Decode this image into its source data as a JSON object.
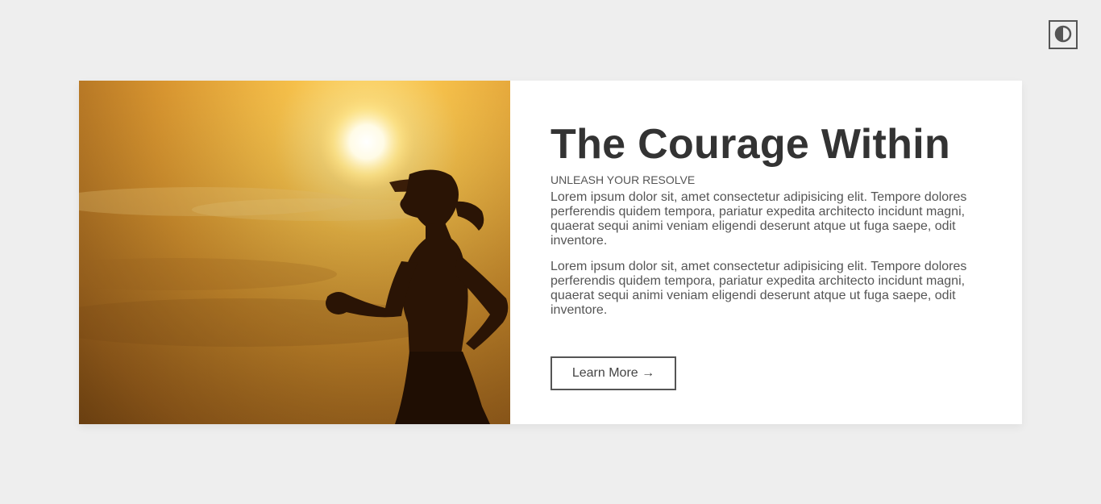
{
  "theme_toggle": {
    "icon": "contrast-icon"
  },
  "hero": {
    "image": "runner-silhouette-sunset",
    "alt": "Silhouette of a woman running at sunset"
  },
  "article": {
    "title": "The Courage Within",
    "subtitle": "UNLEASH YOUR RESOLVE",
    "paragraphs": [
      "Lorem ipsum dolor sit, amet consectetur adipisicing elit. Tempore dolores perferendis quidem tempora, pariatur expedita architecto incidunt magni, quaerat sequi animi veniam eligendi deserunt atque ut fuga saepe, odit inventore.",
      "Lorem ipsum dolor sit, amet consectetur adipisicing elit. Tempore dolores perferendis quidem tempora, pariatur expedita architecto incidunt magni, quaerat sequi animi veniam eligendi deserunt atque ut fuga saepe, odit inventore."
    ],
    "button_label": "Learn More →"
  }
}
